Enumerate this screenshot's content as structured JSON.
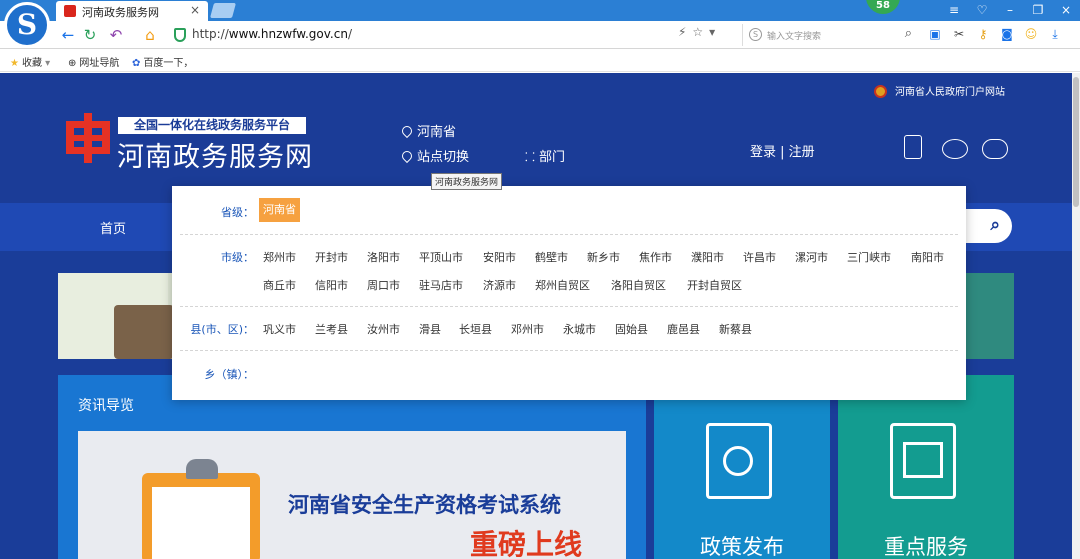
{
  "browser": {
    "tab_title": "河南政务服务网",
    "tab_close": "×",
    "badge": "58",
    "url_prefix": "http://",
    "url_host": "www.hnzwfw.gov.cn",
    "url_suffix": "/",
    "search_placeholder": "输入文字搜索",
    "win_controls": [
      "≡",
      "♡",
      "–",
      "❐",
      "×"
    ]
  },
  "bookmarks": [
    {
      "icon": "★",
      "label": "收藏",
      "caret": "▾"
    },
    {
      "icon": "⊕",
      "label": "网址导航"
    },
    {
      "icon": "✿",
      "label": "百度一下，"
    }
  ],
  "header": {
    "gov_portal": "河南省人民政府门户网站",
    "slogan": "全国一体化在线政务服务平台",
    "site_name": "河南政务服务网",
    "current_region": "河南省",
    "switch_site": "站点切换",
    "department": "部门",
    "login": "登录 | 注册",
    "tooltip": "河南政务服务网"
  },
  "nav": {
    "home": "首页",
    "search_icon": "search-icon"
  },
  "dropdown": {
    "province_label": "省级：",
    "province_selected": "河南省",
    "city_label": "市级：",
    "cities_row1": [
      "郑州市",
      "开封市",
      "洛阳市",
      "平顶山市",
      "安阳市",
      "鹤壁市",
      "新乡市",
      "焦作市",
      "濮阳市",
      "许昌市",
      "漯河市",
      "三门峡市",
      "南阳市"
    ],
    "cities_row2": [
      "商丘市",
      "信阳市",
      "周口市",
      "驻马店市",
      "济源市",
      "郑州自贸区",
      "洛阳自贸区",
      "开封自贸区"
    ],
    "county_label": "县(市、区)：",
    "counties": [
      "巩义市",
      "兰考县",
      "汝州市",
      "滑县",
      "长垣县",
      "邓州市",
      "永城市",
      "固始县",
      "鹿邑县",
      "新蔡县"
    ],
    "town_label": "乡（镇）："
  },
  "news": {
    "title": "资讯导览",
    "exam_title": "河南省安全生产资格考试系统",
    "exam_sub": "重磅上线"
  },
  "tiles": {
    "policy": "政策发布",
    "service": "重点服务"
  },
  "colors": {
    "header_bg": "#1b3c97",
    "nav_bg": "#1f49b4",
    "province_chip": "#f6a140",
    "label_blue": "#1a56b8",
    "policy_tile": "#1389c9",
    "service_tile": "#139c90",
    "brand_red": "#e63224"
  }
}
